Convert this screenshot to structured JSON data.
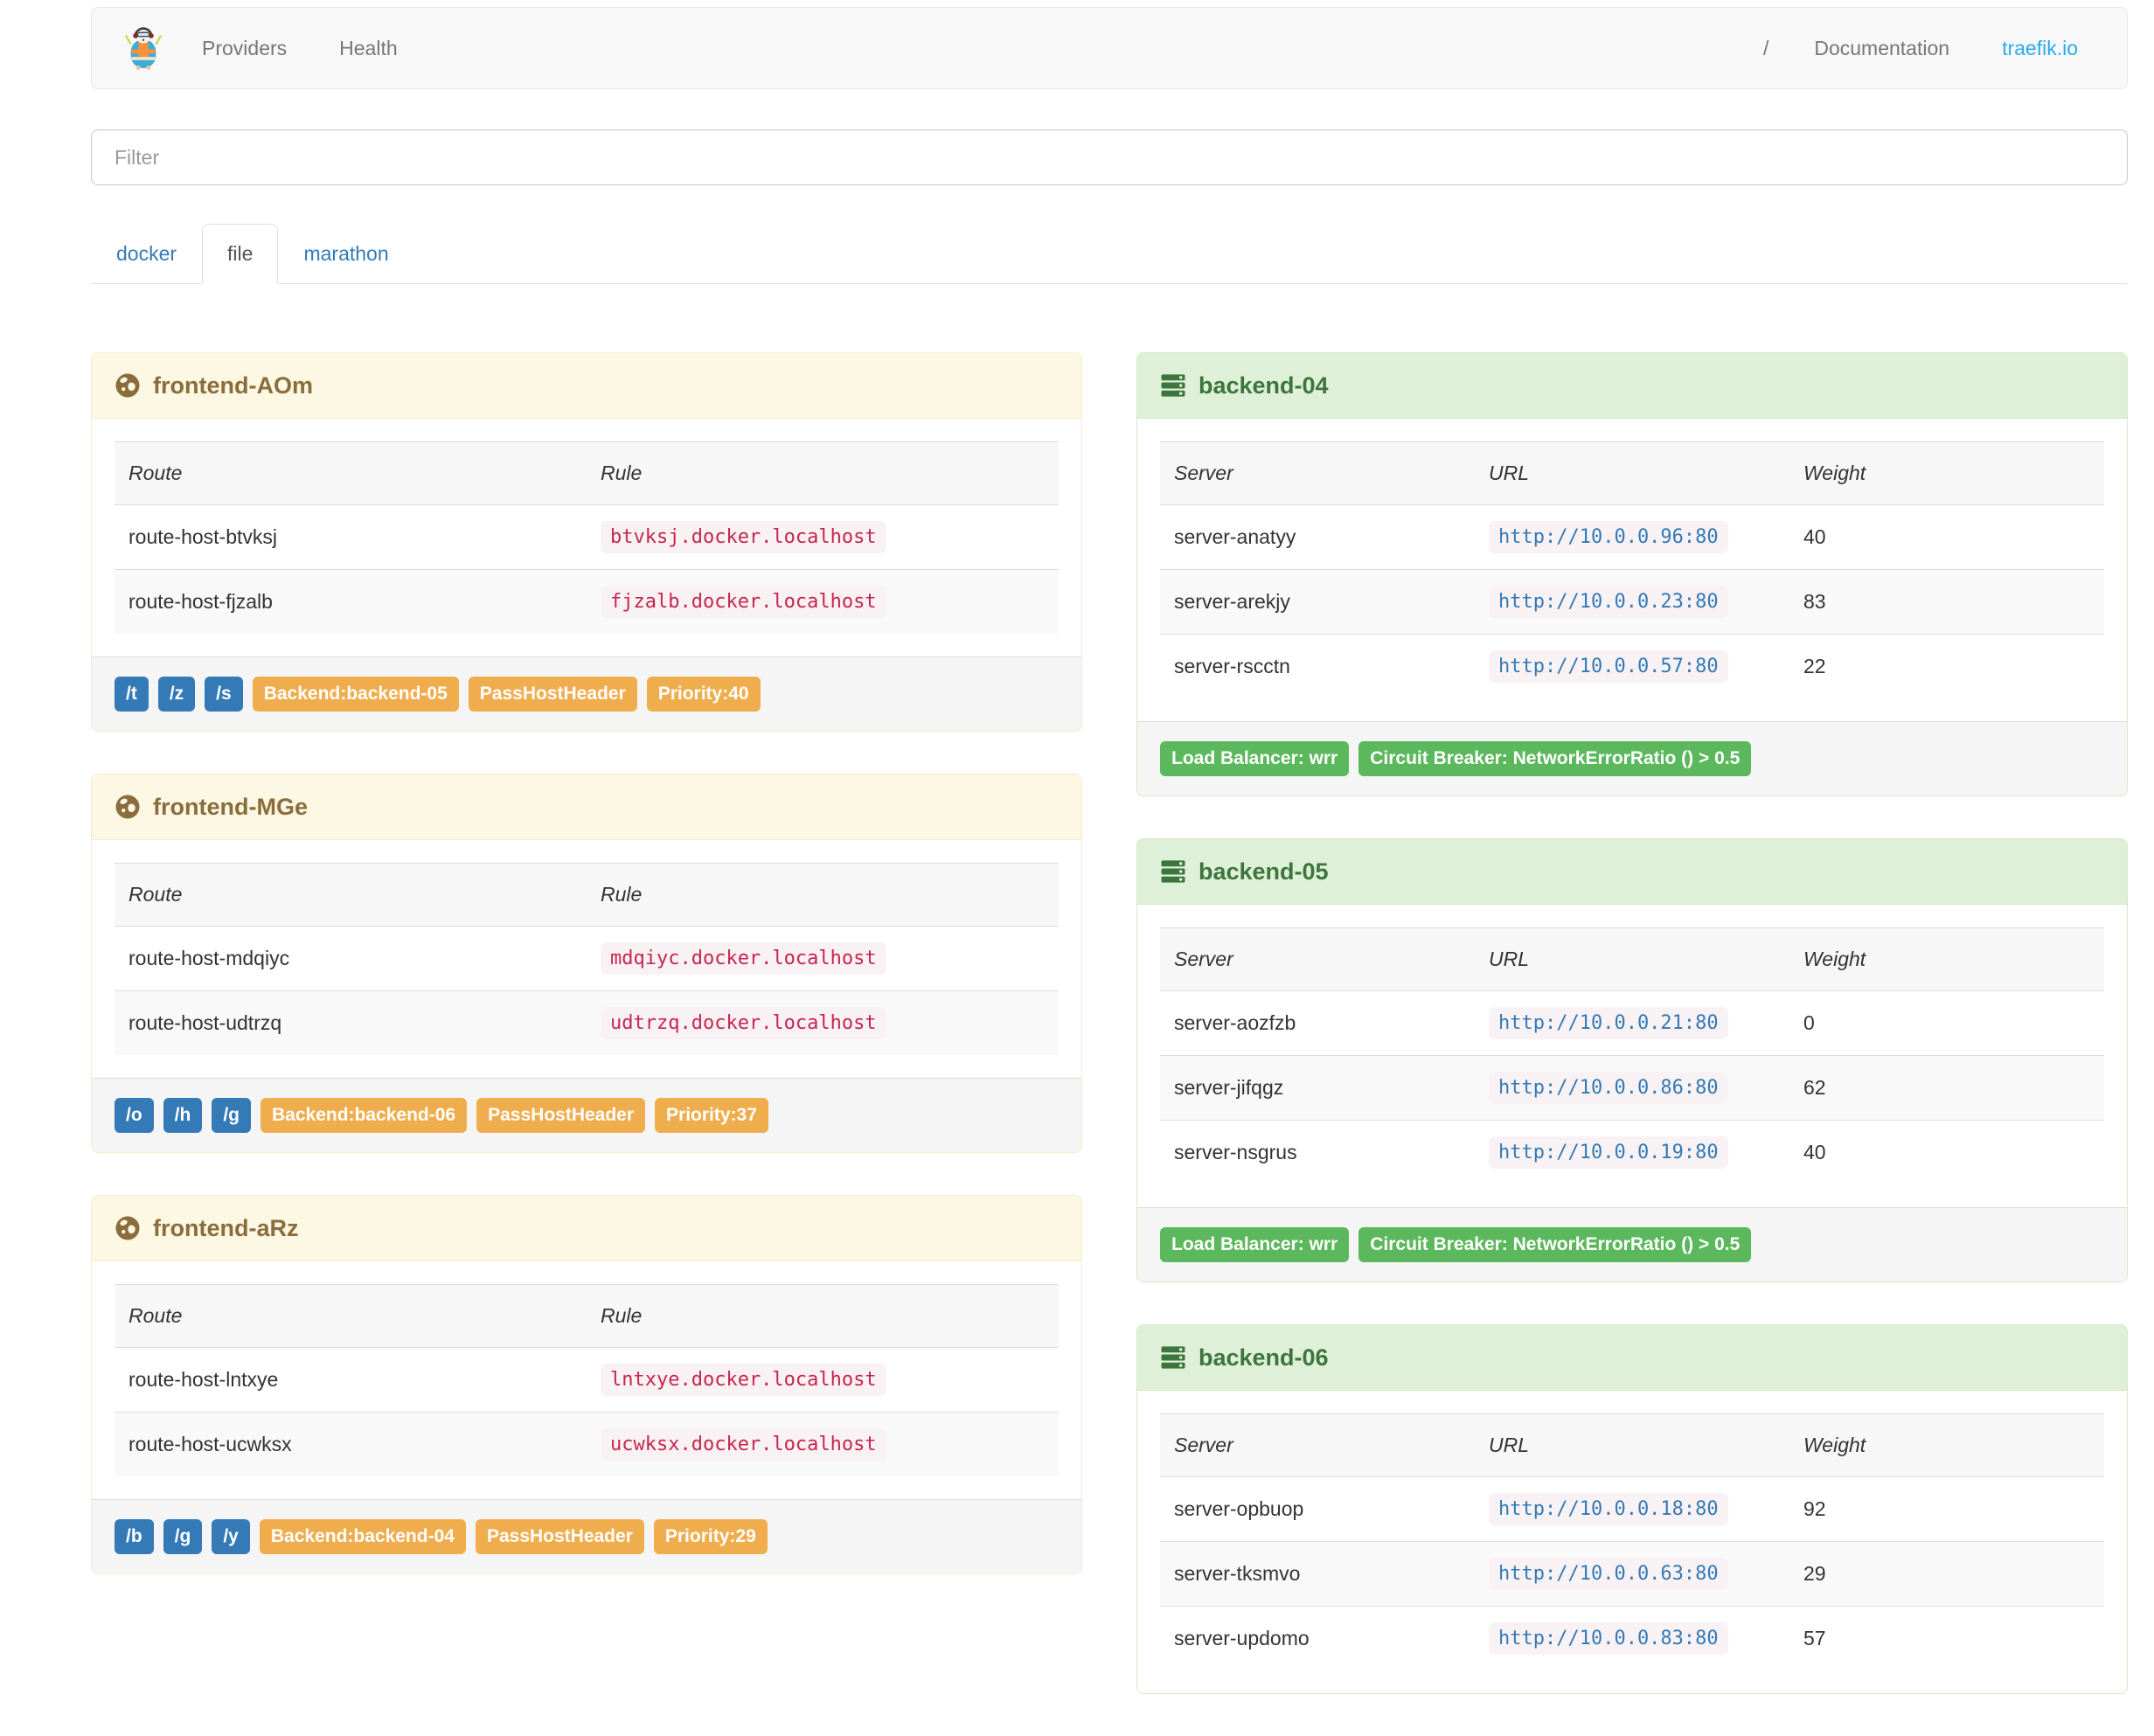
{
  "colors": {
    "accent_blue": "#337ab7",
    "brand_blue": "#29aaf2",
    "warning_orange": "#f0ad4e",
    "success_green": "#5cb85c",
    "frontend_header_bg": "#fcf8e3",
    "frontend_text": "#8a6d3b",
    "frontend_border": "#faebcc",
    "backend_header_bg": "#dff0d8",
    "backend_text": "#3c763d",
    "backend_border": "#d6e9c6",
    "code_pink": "#c7254e",
    "code_bg": "#f9f2f4"
  },
  "navbar": {
    "brand_icon": "traefik-logo",
    "left_links": [
      {
        "label": "Providers"
      },
      {
        "label": "Health"
      }
    ],
    "right_links": [
      {
        "label": "/"
      },
      {
        "label": "Documentation"
      },
      {
        "label": "traefik.io"
      }
    ]
  },
  "filter": {
    "placeholder": "Filter"
  },
  "tabs": [
    {
      "label": "docker",
      "active": false
    },
    {
      "label": "file",
      "active": true
    },
    {
      "label": "marathon",
      "active": false
    }
  ],
  "columns": {
    "frontend": [
      "Route",
      "Rule"
    ],
    "backend": [
      "Server",
      "URL",
      "Weight"
    ]
  },
  "frontends": [
    {
      "title": "frontend-AOm",
      "icon": "globe-icon",
      "routes": [
        {
          "route": "route-host-btvksj",
          "rule": "btvksj.docker.localhost"
        },
        {
          "route": "route-host-fjzalb",
          "rule": "fjzalb.docker.localhost"
        }
      ],
      "entry_points": [
        "/t",
        "/z",
        "/s"
      ],
      "tags": [
        "Backend:backend-05",
        "PassHostHeader",
        "Priority:40"
      ]
    },
    {
      "title": "frontend-MGe",
      "icon": "globe-icon",
      "routes": [
        {
          "route": "route-host-mdqiyc",
          "rule": "mdqiyc.docker.localhost"
        },
        {
          "route": "route-host-udtrzq",
          "rule": "udtrzq.docker.localhost"
        }
      ],
      "entry_points": [
        "/o",
        "/h",
        "/g"
      ],
      "tags": [
        "Backend:backend-06",
        "PassHostHeader",
        "Priority:37"
      ]
    },
    {
      "title": "frontend-aRz",
      "icon": "globe-icon",
      "routes": [
        {
          "route": "route-host-lntxye",
          "rule": "lntxye.docker.localhost"
        },
        {
          "route": "route-host-ucwksx",
          "rule": "ucwksx.docker.localhost"
        }
      ],
      "entry_points": [
        "/b",
        "/g",
        "/y"
      ],
      "tags": [
        "Backend:backend-04",
        "PassHostHeader",
        "Priority:29"
      ]
    }
  ],
  "backends": [
    {
      "title": "backend-04",
      "icon": "server-stack-icon",
      "servers": [
        {
          "server": "server-anatyy",
          "url": "http://10.0.0.96:80",
          "weight": "40"
        },
        {
          "server": "server-arekjy",
          "url": "http://10.0.0.23:80",
          "weight": "83"
        },
        {
          "server": "server-rscctn",
          "url": "http://10.0.0.57:80",
          "weight": "22"
        }
      ],
      "tags": [
        "Load Balancer: wrr",
        "Circuit Breaker: NetworkErrorRatio () > 0.5"
      ]
    },
    {
      "title": "backend-05",
      "icon": "server-stack-icon",
      "servers": [
        {
          "server": "server-aozfzb",
          "url": "http://10.0.0.21:80",
          "weight": "0"
        },
        {
          "server": "server-jifqgz",
          "url": "http://10.0.0.86:80",
          "weight": "62"
        },
        {
          "server": "server-nsgrus",
          "url": "http://10.0.0.19:80",
          "weight": "40"
        }
      ],
      "tags": [
        "Load Balancer: wrr",
        "Circuit Breaker: NetworkErrorRatio () > 0.5"
      ]
    },
    {
      "title": "backend-06",
      "icon": "server-stack-icon",
      "servers": [
        {
          "server": "server-opbuop",
          "url": "http://10.0.0.18:80",
          "weight": "92"
        },
        {
          "server": "server-tksmvo",
          "url": "http://10.0.0.63:80",
          "weight": "29"
        },
        {
          "server": "server-updomo",
          "url": "http://10.0.0.83:80",
          "weight": "57"
        }
      ],
      "tags": []
    }
  ]
}
